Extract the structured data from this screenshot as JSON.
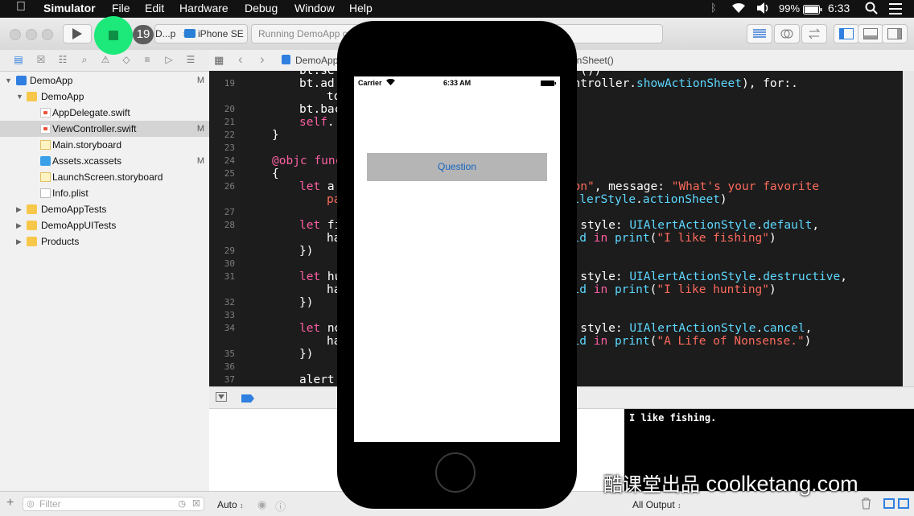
{
  "menubar": {
    "app_name": "Simulator",
    "menus": [
      "File",
      "Edit",
      "Hardware",
      "Debug",
      "Window",
      "Help"
    ],
    "battery": "99%",
    "time": "6:33"
  },
  "toolbar": {
    "badge_count": "19",
    "scheme": "D...p",
    "device": "iPhone SE",
    "activity": "Running DemoApp o"
  },
  "navigator": {
    "items": [
      {
        "label": "DemoApp",
        "status": "M"
      },
      {
        "label": "DemoApp",
        "status": ""
      },
      {
        "label": "AppDelegate.swift",
        "status": ""
      },
      {
        "label": "ViewController.swift",
        "status": "M"
      },
      {
        "label": "Main.storyboard",
        "status": ""
      },
      {
        "label": "Assets.xcassets",
        "status": "M"
      },
      {
        "label": "LaunchScreen.storyboard",
        "status": ""
      },
      {
        "label": "Info.plist",
        "status": ""
      },
      {
        "label": "DemoAppTests",
        "status": ""
      },
      {
        "label": "DemoAppUITests",
        "status": ""
      },
      {
        "label": "Products",
        "status": ""
      }
    ],
    "filter_placeholder": "Filter"
  },
  "jumpbar": {
    "project": "DemoApp",
    "function": "onSheet()"
  },
  "editor": {
    "line_numbers": [
      "19",
      "20",
      "21",
      "22",
      "23",
      "24",
      "25",
      "26",
      "27",
      "28",
      "29",
      "30",
      "31",
      "32",
      "33",
      "34",
      "35",
      "36",
      "37"
    ]
  },
  "debug": {
    "auto_label": "Auto",
    "output_label": "All Output",
    "console_text": "I like fishing."
  },
  "simulator": {
    "carrier": "Carrier",
    "time": "6:33 AM",
    "button_label": "Question"
  },
  "watermark": {
    "cn": "酷课堂出品",
    "en": "coolketang.com"
  }
}
